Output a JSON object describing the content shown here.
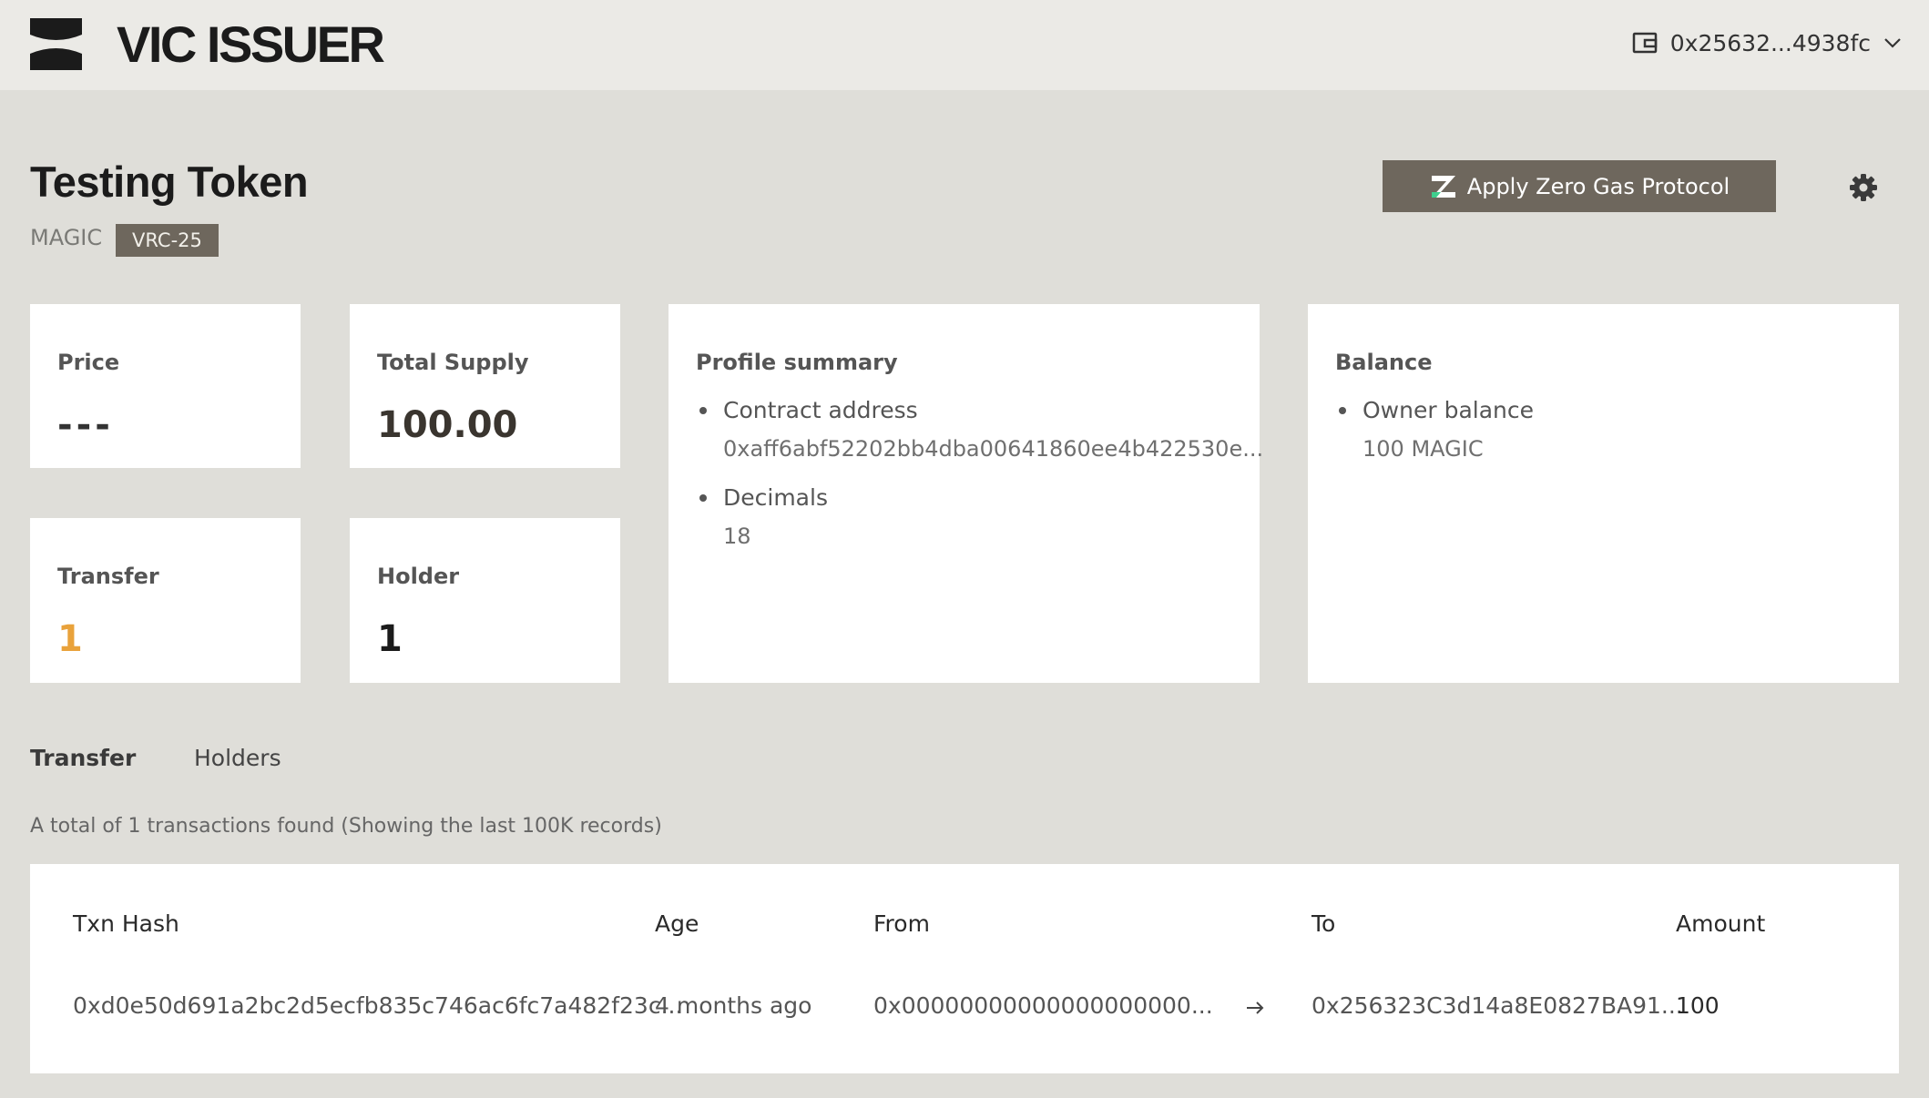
{
  "header": {
    "brand": "VIC ISSUER",
    "wallet_address": "0x25632...4938fc",
    "icons": {
      "logo": "brand-logo-icon",
      "wallet": "wallet-icon",
      "dropdown": "chevron-down-icon"
    }
  },
  "token": {
    "name": "Testing Token",
    "symbol": "MAGIC",
    "standard": "VRC-25"
  },
  "actions": {
    "zero_gas_label": "Apply Zero Gas Protocol",
    "icons": {
      "zero_gas": "zero-gas-icon",
      "settings": "gear-icon"
    },
    "colors": {
      "button_bg": "#6e675d",
      "accent_green": "#3ecf8e"
    }
  },
  "stats": {
    "price": {
      "label": "Price",
      "value": "---"
    },
    "total_supply": {
      "label": "Total Supply",
      "value": "100.00"
    },
    "transfer": {
      "label": "Transfer",
      "value": "1"
    },
    "holder": {
      "label": "Holder",
      "value": "1"
    }
  },
  "profile": {
    "title": "Profile summary",
    "contract_label": "Contract address",
    "contract_value": "0xaff6abf52202bb4dba00641860ee4b422530e...",
    "decimals_label": "Decimals",
    "decimals_value": "18"
  },
  "balance": {
    "title": "Balance",
    "owner_label": "Owner balance",
    "owner_value": "100 MAGIC"
  },
  "tabs": [
    {
      "label": "Transfer",
      "active": true
    },
    {
      "label": "Holders",
      "active": false
    }
  ],
  "transactions": {
    "summary": "A total of 1 transactions found (Showing the last 100K records)",
    "columns": [
      "Txn Hash",
      "Age",
      "From",
      "To",
      "Amount"
    ],
    "rows": [
      {
        "hash": "0xd0e50d691a2bc2d5ecfb835c746ac6fc7a482f23c...",
        "age": "4 months ago",
        "from": "0x00000000000000000000...",
        "to": "0x256323C3d14a8E0827BA91...",
        "amount": "100"
      }
    ]
  }
}
